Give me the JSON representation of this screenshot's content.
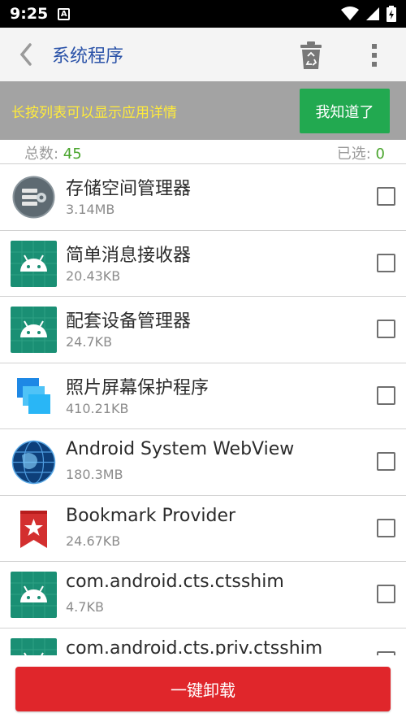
{
  "status": {
    "time": "9:25",
    "notify_letter": "A"
  },
  "toolbar": {
    "title": "系统程序"
  },
  "tip": {
    "text": "长按列表可以显示应用详情",
    "button": "我知道了"
  },
  "counts": {
    "total_label": "总数: ",
    "total_value": "45",
    "selected_label": "已选: ",
    "selected_value": "0"
  },
  "apps": [
    {
      "name": "存储空间管理器",
      "size": "3.14MB",
      "icon": "storage-manager-icon"
    },
    {
      "name": "简单消息接收器",
      "size": "20.43KB",
      "icon": "android-icon"
    },
    {
      "name": "配套设备管理器",
      "size": "24.7KB",
      "icon": "android-icon"
    },
    {
      "name": "照片屏幕保护程序",
      "size": "410.21KB",
      "icon": "photo-screensaver-icon"
    },
    {
      "name": "Android System WebView",
      "size": "180.3MB",
      "icon": "webview-globe-icon"
    },
    {
      "name": "Bookmark Provider",
      "size": "24.67KB",
      "icon": "bookmark-icon"
    },
    {
      "name": "com.android.cts.ctsshim",
      "size": "4.7KB",
      "icon": "android-icon"
    },
    {
      "name": "com.android.cts.priv.ctsshim",
      "size": "",
      "icon": "android-icon"
    }
  ],
  "footer": {
    "uninstall_label": "一键卸载"
  },
  "colors": {
    "title": "#2a52a8",
    "tip_text": "#ffeb3b",
    "ok": "#22a950",
    "count_value": "#4aa52d",
    "uninstall": "#e0262b",
    "android_tile": "#1a8f74"
  }
}
